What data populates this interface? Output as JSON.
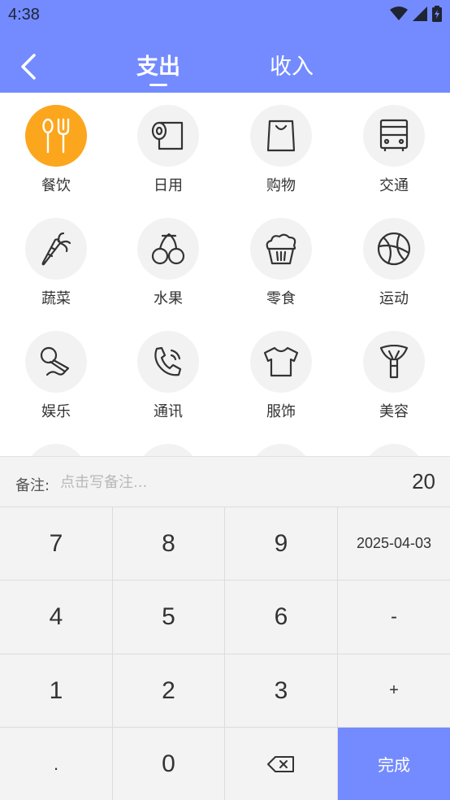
{
  "status_bar": {
    "time": "4:38"
  },
  "header": {
    "tabs": [
      {
        "label": "支出",
        "active": true
      },
      {
        "label": "收入",
        "active": false
      }
    ],
    "accent_color": "#738bff"
  },
  "categories": [
    {
      "label": "餐饮",
      "icon": "spoon-fork-icon",
      "selected": true
    },
    {
      "label": "日用",
      "icon": "toilet-paper-icon"
    },
    {
      "label": "购物",
      "icon": "shopping-bag-icon"
    },
    {
      "label": "交通",
      "icon": "bus-icon"
    },
    {
      "label": "蔬菜",
      "icon": "carrot-icon"
    },
    {
      "label": "水果",
      "icon": "cherry-icon"
    },
    {
      "label": "零食",
      "icon": "cupcake-icon"
    },
    {
      "label": "运动",
      "icon": "basketball-icon"
    },
    {
      "label": "娱乐",
      "icon": "microphone-icon"
    },
    {
      "label": "通讯",
      "icon": "phone-icon"
    },
    {
      "label": "服饰",
      "icon": "shirt-icon"
    },
    {
      "label": "美容",
      "icon": "makeup-brush-icon"
    }
  ],
  "selected_color": "#fba61d",
  "remark": {
    "label": "备注:",
    "placeholder": "点击写备注..."
  },
  "amount": "20",
  "keypad": {
    "keys": [
      "7",
      "8",
      "9",
      "4",
      "5",
      "6",
      "1",
      "2",
      "3",
      ".",
      "0"
    ],
    "date": "2025-04-03",
    "minus": "-",
    "plus": "+",
    "done": "完成"
  }
}
